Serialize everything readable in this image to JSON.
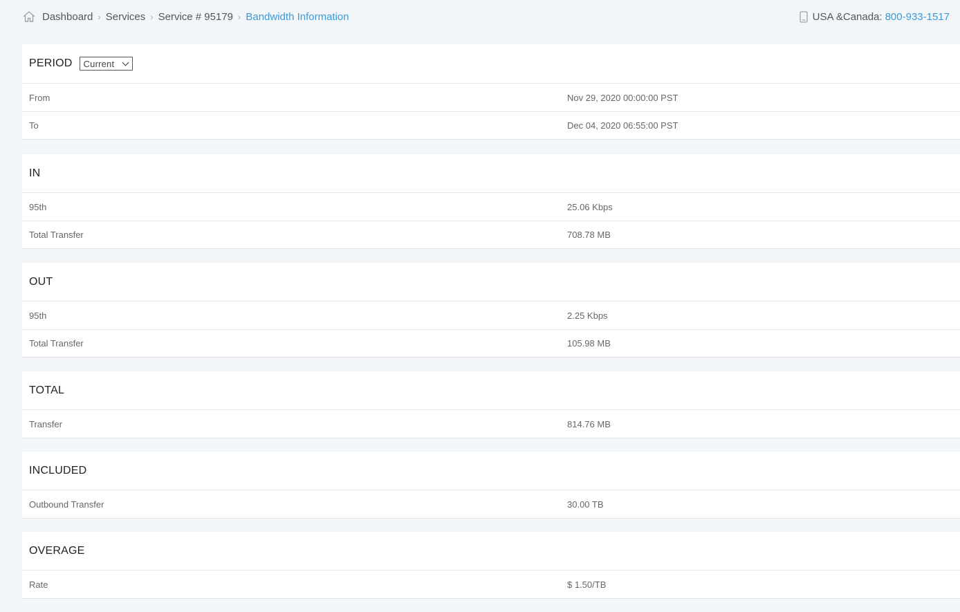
{
  "breadcrumb": {
    "items": [
      "Dashboard",
      "Services",
      "Service # 95179",
      "Bandwidth Information"
    ],
    "separator": ">"
  },
  "contact": {
    "label": "USA &Canada:",
    "number": "800-933-1517"
  },
  "period": {
    "title": "PERIOD",
    "selected": "Current",
    "rows": [
      {
        "label": "From",
        "value": "Nov 29, 2020 00:00:00 PST"
      },
      {
        "label": "To",
        "value": "Dec 04, 2020 06:55:00 PST"
      }
    ]
  },
  "in": {
    "title": "IN",
    "rows": [
      {
        "label": "95th",
        "value": "25.06 Kbps"
      },
      {
        "label": "Total Transfer",
        "value": "708.78 MB"
      }
    ]
  },
  "out": {
    "title": "OUT",
    "rows": [
      {
        "label": "95th",
        "value": "2.25 Kbps"
      },
      {
        "label": "Total Transfer",
        "value": "105.98 MB"
      }
    ]
  },
  "total": {
    "title": "TOTAL",
    "rows": [
      {
        "label": "Transfer",
        "value": "814.76 MB"
      }
    ]
  },
  "included": {
    "title": "INCLUDED",
    "rows": [
      {
        "label": "Outbound Transfer",
        "value": "30.00 TB"
      }
    ]
  },
  "overage": {
    "title": "OVERAGE",
    "rows": [
      {
        "label": "Rate",
        "value": "$ 1.50/TB"
      }
    ]
  },
  "colors": {
    "accent": "#3c9ad6",
    "background": "#f3f6f9"
  }
}
